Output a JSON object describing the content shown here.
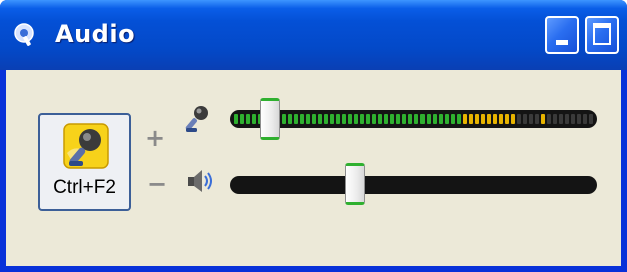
{
  "window": {
    "title": "Audio",
    "title_icon": "settings-pin-icon",
    "accent": "#0a5ee8",
    "controls": {
      "minimize_icon": "minimize-icon",
      "maximize_icon": "maximize-icon"
    }
  },
  "hotkey": {
    "label": "Ctrl+F2",
    "icon": "microphone-icon"
  },
  "microphone": {
    "adjust_symbol": "+",
    "icon": "microphone-small-icon",
    "level_fraction": 0.11,
    "meter_segments": 60,
    "meter_colors": {
      "active": "#2fb02f",
      "peak": "#e8b400",
      "inactive": "#3a3a3a"
    }
  },
  "speaker": {
    "adjust_symbol": "−",
    "icon": "speaker-icon",
    "level_fraction": 0.34
  }
}
